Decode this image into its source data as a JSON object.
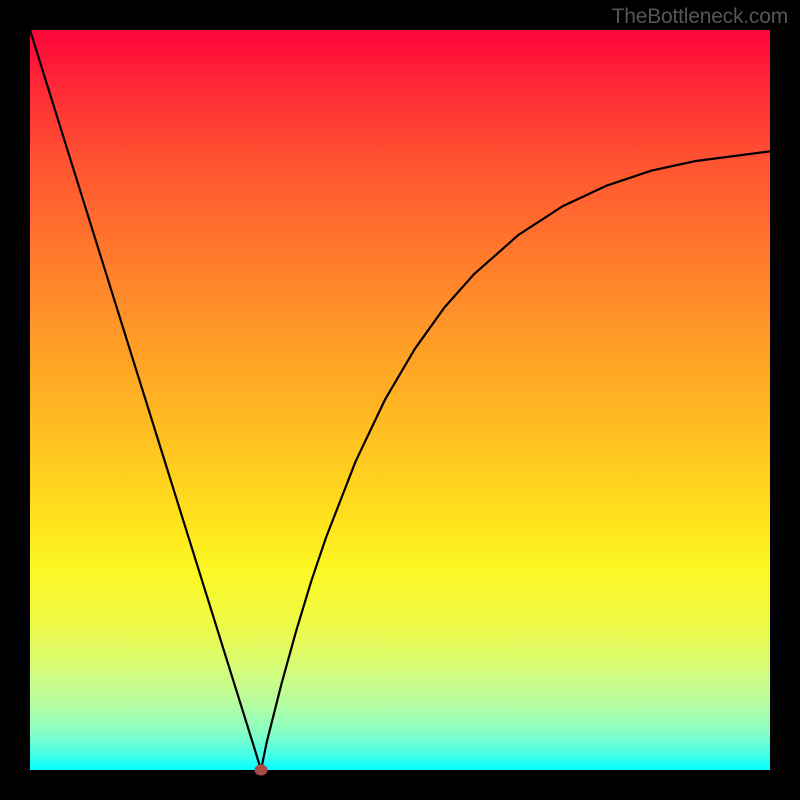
{
  "watermark": "TheBottleneck.com",
  "colors": {
    "background": "#000000",
    "curve": "#000000",
    "marker": "#aa4b47",
    "gradient_top": "#fe043a",
    "gradient_bottom": "#00ffff"
  },
  "chart_data": {
    "type": "line",
    "title": "",
    "xlabel": "",
    "ylabel": "",
    "x": [
      0.0,
      0.02,
      0.04,
      0.06,
      0.08,
      0.1,
      0.12,
      0.14,
      0.16,
      0.18,
      0.2,
      0.22,
      0.24,
      0.26,
      0.28,
      0.3,
      0.3122,
      0.32,
      0.34,
      0.36,
      0.38,
      0.4,
      0.44,
      0.48,
      0.52,
      0.56,
      0.6,
      0.66,
      0.72,
      0.78,
      0.84,
      0.9,
      1.0
    ],
    "values": [
      1.0,
      0.936,
      0.872,
      0.808,
      0.744,
      0.68,
      0.616,
      0.552,
      0.488,
      0.424,
      0.36,
      0.296,
      0.232,
      0.168,
      0.104,
      0.04,
      0.0,
      0.038,
      0.117,
      0.189,
      0.255,
      0.314,
      0.417,
      0.501,
      0.569,
      0.625,
      0.67,
      0.723,
      0.762,
      0.79,
      0.81,
      0.823,
      0.836
    ],
    "xlim": [
      0,
      1
    ],
    "ylim": [
      0,
      1
    ],
    "marker": {
      "x": 0.3122,
      "y": 0.0
    },
    "annotations": []
  }
}
